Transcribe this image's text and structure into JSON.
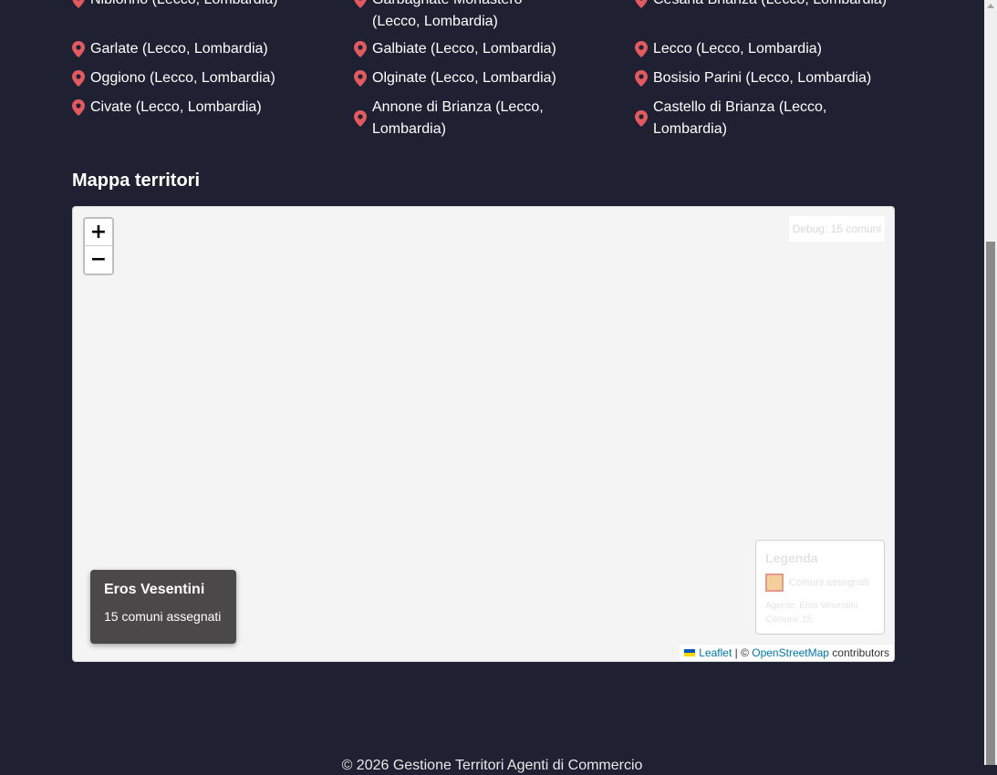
{
  "comuni": [
    "Nibionno (Lecco, Lombardia)",
    "Garbagnate Monastero (Lecco, Lombardia)",
    "Cesana Brianza (Lecco, Lombardia)",
    "Garlate (Lecco, Lombardia)",
    "Galbiate (Lecco, Lombardia)",
    "Lecco (Lecco, Lombardia)",
    "Oggiono (Lecco, Lombardia)",
    "Olginate (Lecco, Lombardia)",
    "Bosisio Parini (Lecco, Lombardia)",
    "Civate (Lecco, Lombardia)",
    "Annone di Brianza (Lecco, Lombardia)",
    "Castello di Brianza (Lecco, Lombardia)"
  ],
  "map_section": {
    "title": "Mappa territori",
    "zoom_in": "+",
    "zoom_out": "−",
    "debug": "Debug: 15 comuni",
    "legend": {
      "title": "Legenda",
      "swatch_label": "Comuni assegnati",
      "agent_line": "Agente: Eros Vesentini",
      "count_line": "Comuni: 15"
    },
    "agent_card": {
      "name": "Eros Vesentini",
      "count": "15 comuni assegnati"
    },
    "attribution": {
      "leaflet": "Leaflet",
      "separator": " | © ",
      "osm": "OpenStreetMap",
      "suffix": " contributors"
    }
  },
  "footer": {
    "text": "© 2026 Gestione Territori Agenti di Commercio"
  },
  "colors": {
    "background": "#1f2133",
    "pin": "#e05a5f",
    "map_bg": "#f4f4f4",
    "link": "#0078a8",
    "legend_swatch": "#f3cf9b"
  }
}
